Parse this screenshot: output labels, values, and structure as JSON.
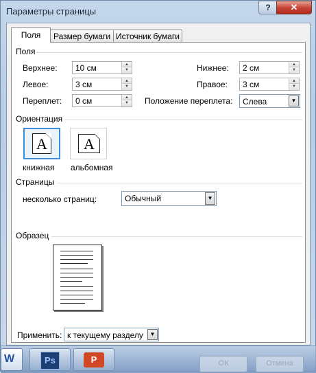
{
  "window": {
    "title": "Параметры страницы",
    "help_label": "?",
    "close_label": "✕"
  },
  "tabs": [
    {
      "label": "Поля",
      "active": true
    },
    {
      "label": "Размер бумаги",
      "active": false
    },
    {
      "label": "Источник бумаги",
      "active": false
    }
  ],
  "margins": {
    "section_label": "Поля",
    "top": {
      "label": "Верхнее:",
      "value": "10 см"
    },
    "bottom": {
      "label": "Нижнее:",
      "value": "2 см"
    },
    "left": {
      "label": "Левое:",
      "value": "3 см"
    },
    "right": {
      "label": "Правое:",
      "value": "3 см"
    },
    "gutter": {
      "label": "Переплет:",
      "value": "0 см"
    },
    "gutter_position": {
      "label": "Положение переплета:",
      "value": "Слева"
    }
  },
  "orientation": {
    "section_label": "Ориентация",
    "portrait": {
      "label": "книжная",
      "glyph": "A",
      "selected": true
    },
    "landscape": {
      "label": "альбомная",
      "glyph": "A",
      "selected": false
    }
  },
  "pages": {
    "section_label": "Страницы",
    "multiple_label": "несколько страниц:",
    "multiple_value": "Обычный"
  },
  "preview": {
    "section_label": "Образец"
  },
  "apply": {
    "label": "Применить:",
    "value": "к текущему разделу"
  },
  "taskbar": {
    "items": [
      {
        "name": "word-icon",
        "glyph": "W"
      },
      {
        "name": "photoshop-icon",
        "glyph": "Ps"
      },
      {
        "name": "powerpoint-icon",
        "glyph": "P"
      }
    ],
    "ok_label": "ОК",
    "cancel_label": "Отмена"
  },
  "colors": {
    "accent": "#3e8ddd",
    "close": "#c8473a",
    "photoshop": "#1e3f73",
    "powerpoint": "#d24726"
  }
}
